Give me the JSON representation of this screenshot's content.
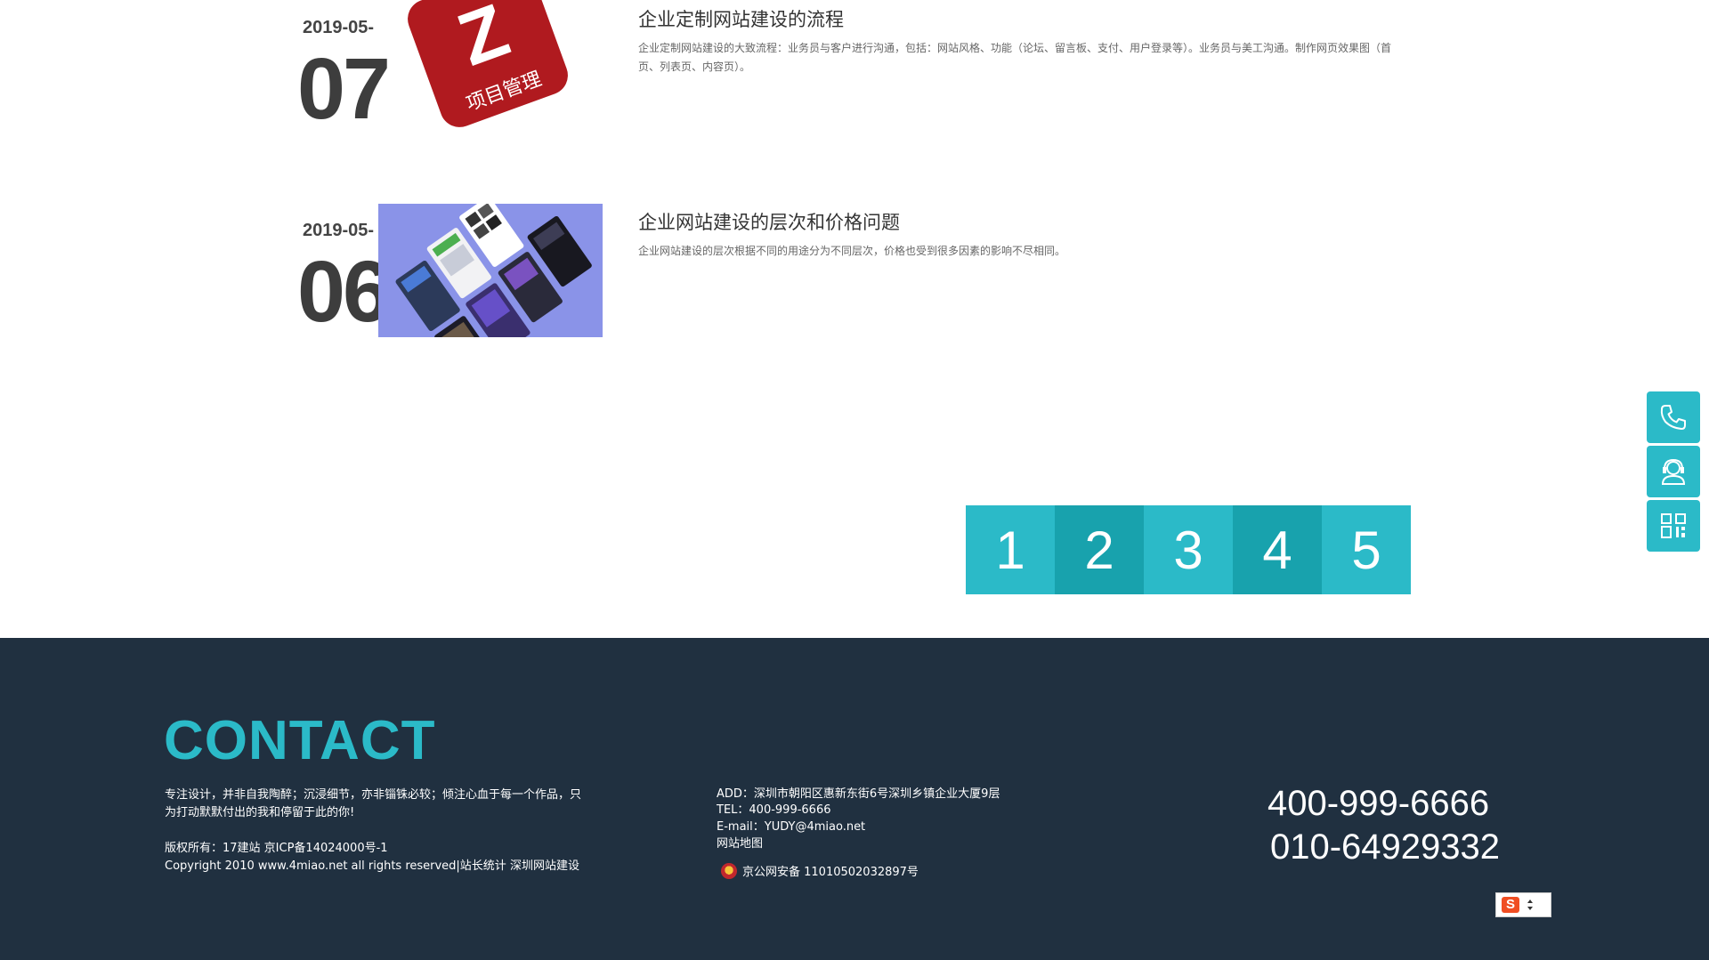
{
  "news": [
    {
      "date_month": "2019-05-",
      "date_day": "07",
      "title": "企业定制网站建设的流程",
      "desc": "企业定制网站建设的大致流程：业务员与客户进行沟通，包括：网站风格、功能（论坛、留言板、支付、用户登录等）。业务员与美工沟通。制作网页效果图（首页、列表页、内容页）。",
      "thumb_label": "项目管理",
      "thumb_letter": "Z"
    },
    {
      "date_month": "2019-05-",
      "date_day": "06",
      "title": "企业网站建设的层次和价格问题",
      "desc": "企业网站建设的层次根据不同的用途分为不同层次，价格也受到很多因素的影响不尽相同。"
    }
  ],
  "pagination": {
    "pages": [
      "1",
      "2",
      "3",
      "4",
      "5"
    ]
  },
  "side_bar": {
    "icons": [
      "phone-icon",
      "customer-service-icon",
      "qrcode-icon"
    ]
  },
  "footer": {
    "heading": "CONTACT",
    "slogan": "专注设计，并非自我陶醉；沉浸细节，亦非锱铢必较；倾注心血于每一个作品，只为打动默默付出的我和停留于此的你!",
    "copyright_line1": "版权所有：17建站 京ICP备14024000号-1",
    "copyright_line2": "Copyright 2010 www.4miao.net all rights reserved|站长统计 深圳网站建设",
    "address": "ADD：深圳市朝阳区惠新东街6号深圳乡镇企业大厦9层",
    "tel": "TEL：400-999-6666",
    "email": "E-mail：YUDY@4miao.net",
    "sitemap": "网站地图",
    "beian": "京公网安备 11010502032897号",
    "phone1": "400-999-6666",
    "phone2": "010-64929332"
  },
  "colors": {
    "accent": "#2bbac8",
    "accent_dark": "#18a2ad",
    "footer_bg": "#203040",
    "thumb_red": "#b01a1f",
    "thumb_blue": "#8a93e8"
  }
}
